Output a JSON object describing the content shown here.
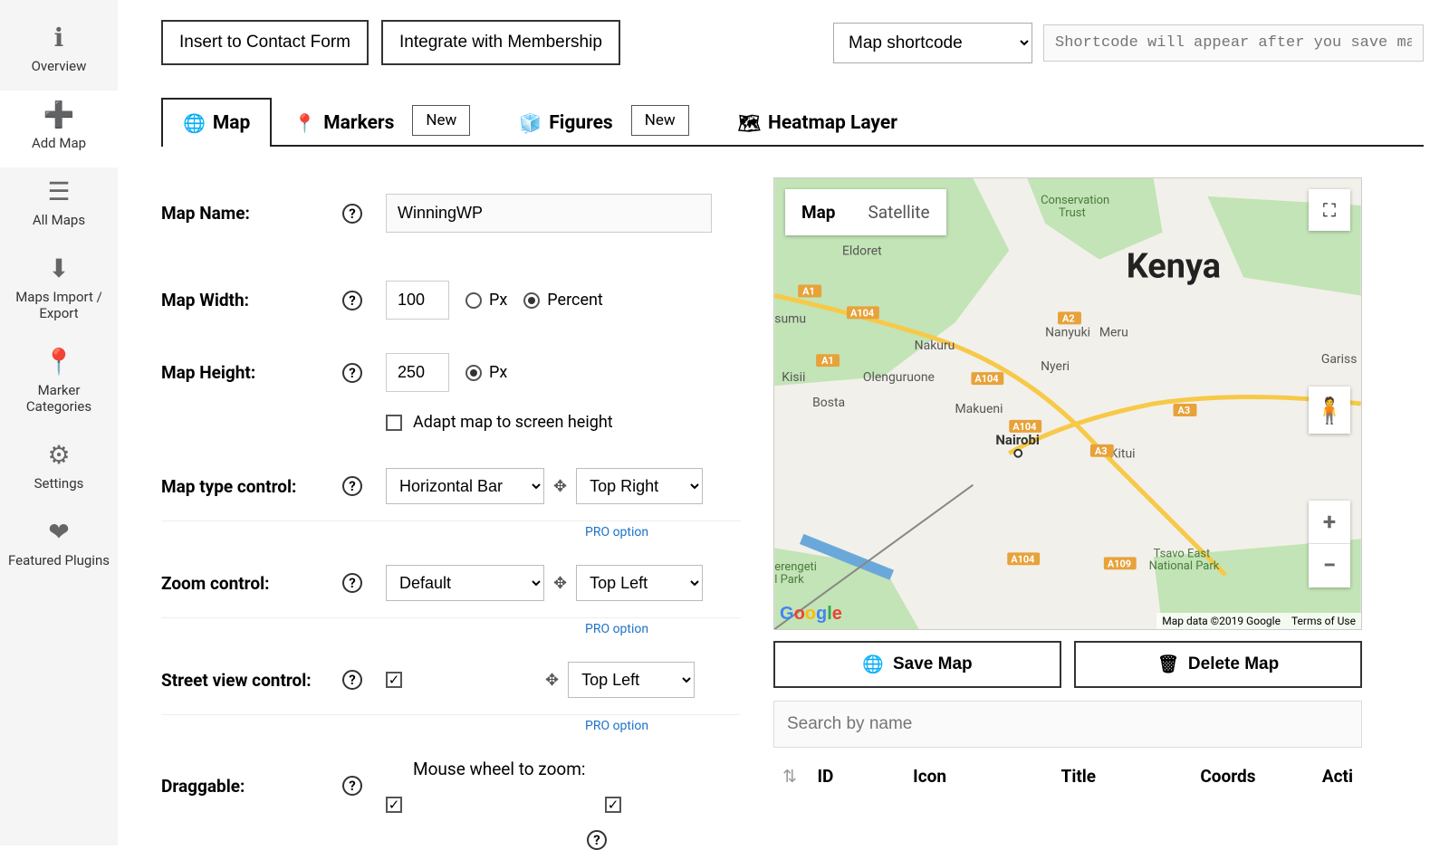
{
  "sidebar": [
    {
      "icon": "ℹ",
      "label": "Overview"
    },
    {
      "icon": "➕",
      "label": "Add Map",
      "active": true
    },
    {
      "icon": "☰",
      "label": "All Maps"
    },
    {
      "icon": "⬇",
      "label": "Maps Import / Export"
    },
    {
      "icon": "📍",
      "label": "Marker Categories"
    },
    {
      "icon": "⚙",
      "label": "Settings"
    },
    {
      "icon": "❤",
      "label": "Featured Plugins"
    }
  ],
  "buttons": {
    "contact": "Insert to Contact Form",
    "member": "Integrate with Membership"
  },
  "shortcode": {
    "select": "Map shortcode",
    "placeholder": "Shortcode will appear after you save map"
  },
  "tabs": {
    "map": "Map",
    "markers": "Markers",
    "figures": "Figures",
    "heatmap": "Heatmap Layer",
    "new": "New"
  },
  "form": {
    "name": {
      "label": "Map Name:",
      "value": "WinningWP"
    },
    "width": {
      "label": "Map Width:",
      "value": "100",
      "unit_px": "Px",
      "unit_pct": "Percent"
    },
    "height": {
      "label": "Map Height:",
      "value": "250",
      "unit": "Px",
      "adapt": "Adapt map to screen height"
    },
    "type": {
      "label": "Map type control:",
      "value": "Horizontal Bar",
      "pos": "Top Right"
    },
    "zoom": {
      "label": "Zoom control:",
      "value": "Default",
      "pos": "Top Left"
    },
    "street": {
      "label": "Street view control:",
      "pos": "Top Left"
    },
    "drag": {
      "label": "Draggable:",
      "wheel": "Mouse wheel to zoom:"
    },
    "pro": "PRO option"
  },
  "map": {
    "map_btn": "Map",
    "sat_btn": "Satellite",
    "title": "Kenya",
    "cities": [
      "Eldoret",
      "sumu",
      "Nakuru",
      "Kisii",
      "Bosta",
      "Nanyuki",
      "Nyeri",
      "Meru",
      "Nairobi",
      "Kitui",
      "Olenguruone",
      "Makueni",
      "Gariss",
      "Conservation Trust",
      "Tsavo East National Park",
      "erengeti l Park"
    ],
    "roads": [
      "A1",
      "A104",
      "A104",
      "A1",
      "A104",
      "A2",
      "A3",
      "A104",
      "A3",
      "A104",
      "A109"
    ],
    "attr1": "Map data ©2019 Google",
    "attr2": "Terms of Use"
  },
  "actions": {
    "save": "Save Map",
    "delete": "Delete Map",
    "search": "Search by name"
  },
  "table": [
    "ID",
    "Icon",
    "Title",
    "Coords",
    "Acti"
  ]
}
